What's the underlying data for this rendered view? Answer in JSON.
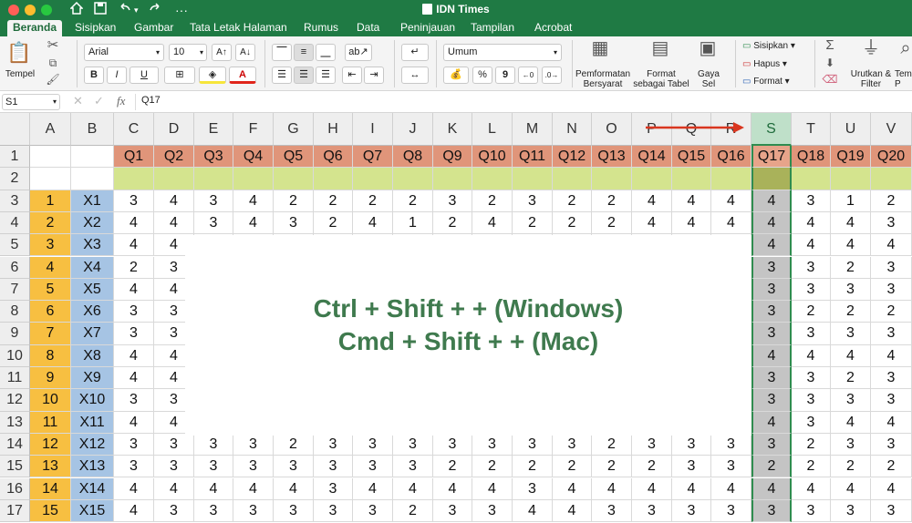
{
  "window": {
    "title": "IDN Times"
  },
  "colors": {
    "brand": "#1f7a44",
    "header_row": "#e0957a",
    "row2": "#d4e48e",
    "col_a": "#f7bf41",
    "col_b": "#a6c4e4",
    "selected_col": "#c4c4c4",
    "note": "#3f7a4e",
    "arrow": "#d9361f"
  },
  "quick_access": {
    "home_icon": "home-icon",
    "save_icon": "save-icon",
    "undo_icon": "undo-icon",
    "redo_icon": "redo-icon",
    "more_icon": "more-icon"
  },
  "tabs": [
    "Beranda",
    "Sisipkan",
    "Gambar",
    "Tata Letak Halaman",
    "Rumus",
    "Data",
    "Peninjauan",
    "Tampilan",
    "Acrobat"
  ],
  "ribbon": {
    "paste_label": "Tempel",
    "font_name": "Arial",
    "font_size": "10",
    "bold": "B",
    "italic": "I",
    "underline": "U",
    "grow_font": "A↑",
    "shrink_font": "A↓",
    "font_color": "A",
    "number_format": "Umum",
    "percent": "%",
    "comma": "9",
    "conditional_format": "Pemformatan Bersyarat",
    "format_table": "Format sebagai Tabel",
    "cell_styles": "Gaya Sel",
    "insert": "Sisipkan",
    "delete": "Hapus",
    "format": "Format",
    "sort_filter": "Urutkan & Filter",
    "find_select": "Temu P"
  },
  "formula_bar": {
    "name_box": "S1",
    "fx": "fx",
    "content": "Q17"
  },
  "columns": [
    "A",
    "B",
    "C",
    "D",
    "E",
    "F",
    "G",
    "H",
    "I",
    "J",
    "K",
    "L",
    "M",
    "N",
    "O",
    "P",
    "Q",
    "R",
    "S",
    "T",
    "U",
    "V"
  ],
  "rows": [
    {
      "num": "1",
      "a": "",
      "b": "",
      "q": [
        "Q1",
        "Q2",
        "Q3",
        "Q4",
        "Q5",
        "Q6",
        "Q7",
        "Q8",
        "Q9",
        "Q10",
        "Q11",
        "Q12",
        "Q13",
        "Q14",
        "Q15",
        "Q16",
        "Q17",
        "Q18",
        "Q19",
        "Q20"
      ]
    },
    {
      "num": "2",
      "a": "",
      "b": "",
      "q": [
        "",
        "",
        "",
        "",
        "",
        "",
        "",
        "",
        "",
        "",
        "",
        "",
        "",
        "",
        "",
        "",
        "",
        "",
        "",
        ""
      ]
    },
    {
      "num": "3",
      "a": "1",
      "b": "X1",
      "q": [
        "3",
        "4",
        "3",
        "4",
        "2",
        "2",
        "2",
        "2",
        "3",
        "2",
        "3",
        "2",
        "2",
        "4",
        "4",
        "4",
        "4",
        "3",
        "1",
        "2"
      ]
    },
    {
      "num": "4",
      "a": "2",
      "b": "X2",
      "q": [
        "4",
        "4",
        "3",
        "4",
        "3",
        "2",
        "4",
        "1",
        "2",
        "4",
        "2",
        "2",
        "2",
        "4",
        "4",
        "4",
        "4",
        "4",
        "4",
        "3"
      ]
    },
    {
      "num": "5",
      "a": "3",
      "b": "X3",
      "q": [
        "4",
        "4",
        "",
        "",
        "",
        "",
        "",
        "",
        "",
        "",
        "",
        "",
        "",
        "",
        "",
        "",
        "4",
        "4",
        "4",
        "4"
      ]
    },
    {
      "num": "6",
      "a": "4",
      "b": "X4",
      "q": [
        "2",
        "3",
        "",
        "",
        "",
        "",
        "",
        "",
        "",
        "",
        "",
        "",
        "",
        "",
        "",
        "",
        "3",
        "3",
        "2",
        "3"
      ]
    },
    {
      "num": "7",
      "a": "5",
      "b": "X5",
      "q": [
        "4",
        "4",
        "",
        "",
        "",
        "",
        "",
        "",
        "",
        "",
        "",
        "",
        "",
        "",
        "",
        "",
        "3",
        "3",
        "3",
        "3"
      ]
    },
    {
      "num": "8",
      "a": "6",
      "b": "X6",
      "q": [
        "3",
        "3",
        "",
        "",
        "",
        "",
        "",
        "",
        "",
        "",
        "",
        "",
        "",
        "",
        "",
        "",
        "3",
        "2",
        "2",
        "2"
      ]
    },
    {
      "num": "9",
      "a": "7",
      "b": "X7",
      "q": [
        "3",
        "3",
        "",
        "",
        "",
        "",
        "",
        "",
        "",
        "",
        "",
        "",
        "",
        "",
        "",
        "",
        "3",
        "3",
        "3",
        "3"
      ]
    },
    {
      "num": "10",
      "a": "8",
      "b": "X8",
      "q": [
        "4",
        "4",
        "",
        "",
        "",
        "",
        "",
        "",
        "",
        "",
        "",
        "",
        "",
        "",
        "",
        "",
        "4",
        "4",
        "4",
        "4"
      ]
    },
    {
      "num": "11",
      "a": "9",
      "b": "X9",
      "q": [
        "4",
        "4",
        "",
        "",
        "",
        "",
        "",
        "",
        "",
        "",
        "",
        "",
        "",
        "",
        "",
        "",
        "3",
        "3",
        "2",
        "3"
      ]
    },
    {
      "num": "12",
      "a": "10",
      "b": "X10",
      "q": [
        "3",
        "3",
        "",
        "",
        "",
        "",
        "",
        "",
        "",
        "",
        "",
        "",
        "",
        "",
        "",
        "",
        "3",
        "3",
        "3",
        "3"
      ]
    },
    {
      "num": "13",
      "a": "11",
      "b": "X11",
      "q": [
        "4",
        "4",
        "",
        "",
        "",
        "",
        "",
        "",
        "",
        "",
        "",
        "",
        "",
        "",
        "",
        "",
        "4",
        "3",
        "4",
        "4"
      ]
    },
    {
      "num": "14",
      "a": "12",
      "b": "X12",
      "q": [
        "3",
        "3",
        "3",
        "3",
        "2",
        "3",
        "3",
        "3",
        "3",
        "3",
        "3",
        "3",
        "2",
        "3",
        "3",
        "3",
        "3",
        "2",
        "3",
        "3"
      ]
    },
    {
      "num": "15",
      "a": "13",
      "b": "X13",
      "q": [
        "3",
        "3",
        "3",
        "3",
        "3",
        "3",
        "3",
        "3",
        "2",
        "2",
        "2",
        "2",
        "2",
        "2",
        "3",
        "3",
        "2",
        "2",
        "2",
        "2"
      ]
    },
    {
      "num": "16",
      "a": "14",
      "b": "X14",
      "q": [
        "4",
        "4",
        "4",
        "4",
        "4",
        "3",
        "4",
        "4",
        "4",
        "4",
        "3",
        "4",
        "4",
        "4",
        "4",
        "4",
        "4",
        "4",
        "4",
        "4"
      ]
    },
    {
      "num": "17",
      "a": "15",
      "b": "X15",
      "q": [
        "4",
        "3",
        "3",
        "3",
        "3",
        "3",
        "3",
        "2",
        "3",
        "3",
        "4",
        "4",
        "3",
        "3",
        "3",
        "3",
        "3",
        "3",
        "3",
        "3"
      ]
    }
  ],
  "note": {
    "line1": "Ctrl + Shift + + (Windows)",
    "line2": "Cmd + Shift  + + (Mac)"
  }
}
